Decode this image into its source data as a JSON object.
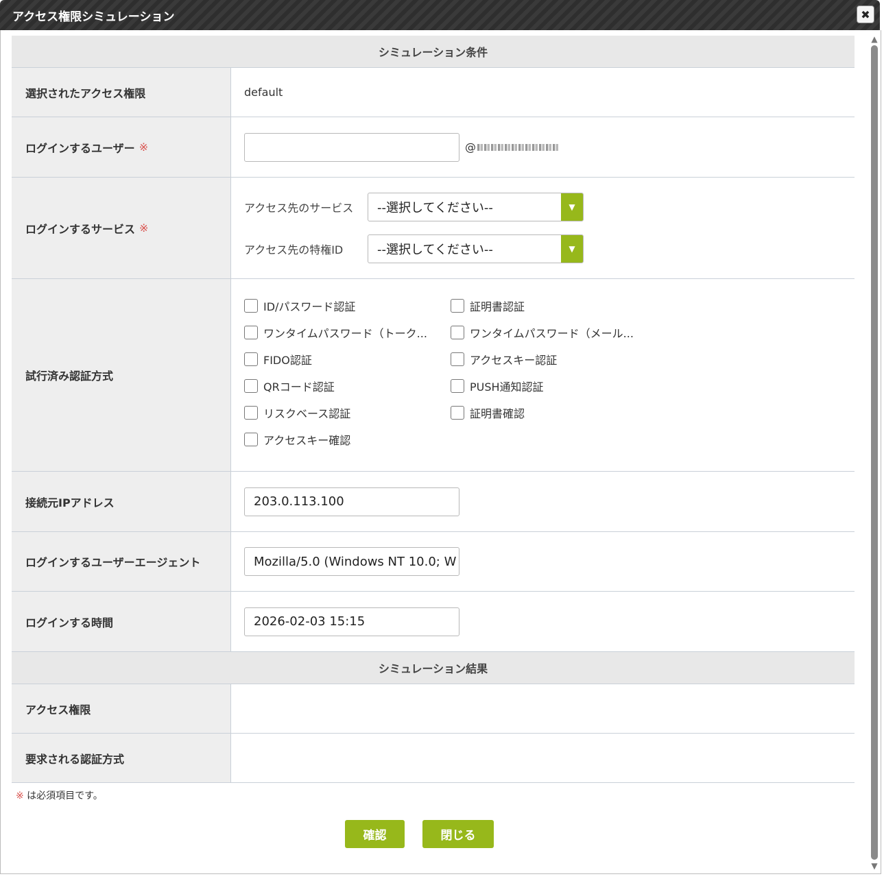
{
  "window": {
    "title": "アクセス権限シミュレーション",
    "close_icon": "✖"
  },
  "conditions": {
    "header": "シミュレーション条件",
    "selected_permission": {
      "label": "選択されたアクセス権限",
      "value": "default"
    },
    "login_user": {
      "label": "ログインするユーザー",
      "required_mark": "※",
      "value": "",
      "domain_prefix": "@"
    },
    "login_service": {
      "label": "ログインするサービス",
      "required_mark": "※",
      "service": {
        "label": "アクセス先のサービス",
        "selected": "--選択してください--"
      },
      "privilege_id": {
        "label": "アクセス先の特権ID",
        "selected": "--選択してください--"
      },
      "arrow_icon": "▼"
    },
    "auth_methods": {
      "label": "試行済み認証方式",
      "items": [
        {
          "label": "ID/パスワード認証",
          "checked": false
        },
        {
          "label": "証明書認証",
          "checked": false
        },
        {
          "label": "ワンタイムパスワード（トーク...",
          "checked": false
        },
        {
          "label": "ワンタイムパスワード（メール...",
          "checked": false
        },
        {
          "label": "FIDO認証",
          "checked": false
        },
        {
          "label": "アクセスキー認証",
          "checked": false
        },
        {
          "label": "QRコード認証",
          "checked": false
        },
        {
          "label": "PUSH通知認証",
          "checked": false
        },
        {
          "label": "リスクベース認証",
          "checked": false
        },
        {
          "label": "証明書確認",
          "checked": false
        },
        {
          "label": "アクセスキー確認",
          "checked": false
        }
      ]
    },
    "source_ip": {
      "label": "接続元IPアドレス",
      "value": "203.0.113.100"
    },
    "user_agent": {
      "label": "ログインするユーザーエージェント",
      "value": "Mozilla/5.0 (Windows NT 10.0; W"
    },
    "login_time": {
      "label": "ログインする時間",
      "value": "2026-02-03 15:15"
    }
  },
  "results": {
    "header": "シミュレーション結果",
    "permission": {
      "label": "アクセス権限",
      "value": ""
    },
    "required_auth": {
      "label": "要求される認証方式",
      "value": ""
    }
  },
  "footnote": {
    "mark": "※",
    "text": " は必須項目です。"
  },
  "buttons": {
    "confirm": "確認",
    "close": "閉じる"
  },
  "colors": {
    "accent": "#97b81b",
    "required": "#d9534f",
    "titlebar": "#333333"
  }
}
